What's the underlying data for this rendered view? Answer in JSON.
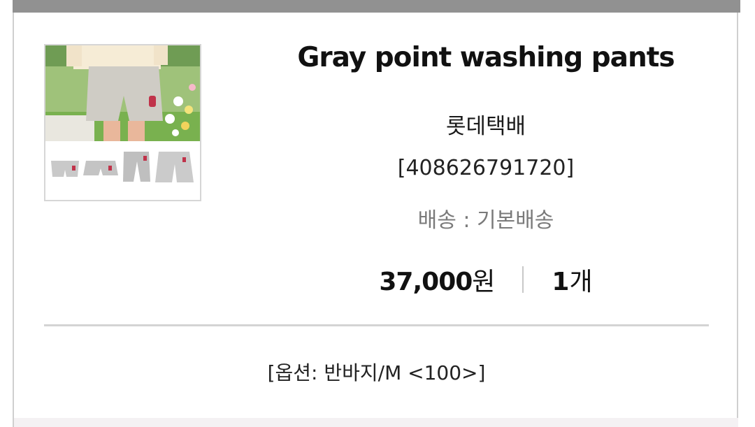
{
  "product": {
    "title": "Gray point washing pants",
    "carrier": "롯데택배",
    "tracking": "[408626791720]",
    "shipping": "배송 : 기본배송",
    "price_number": "37,000",
    "price_unit": "원",
    "qty_number": "1",
    "qty_unit": "개",
    "option": "[옵션: 반바지/M <100>]"
  },
  "colors": {
    "top_bar": "#919191",
    "divider": "#d4d4d4",
    "shipping_text": "#7a7a7a"
  }
}
